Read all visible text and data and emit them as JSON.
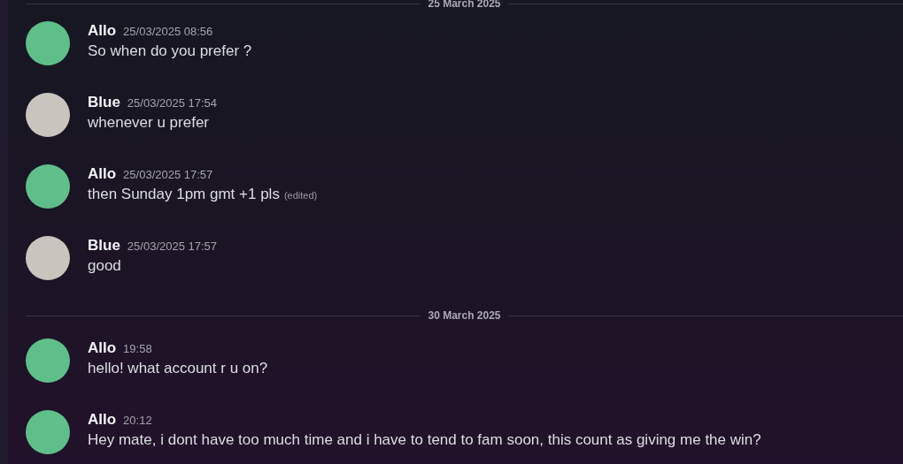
{
  "items": [
    {
      "kind": "divider",
      "label": "25 March 2025"
    },
    {
      "kind": "message",
      "author": "Allo",
      "time": "25/03/2025 08:56",
      "text": "So when do you prefer ?",
      "color": "#5fbf8a"
    },
    {
      "kind": "message",
      "author": "Blue",
      "time": "25/03/2025 17:54",
      "text": "whenever u prefer",
      "color": "#c9c4bd"
    },
    {
      "kind": "message",
      "author": "Allo",
      "time": "25/03/2025 17:57",
      "text": "then Sunday 1pm gmt +1 pls",
      "edited": "(edited)",
      "color": "#5fbf8a"
    },
    {
      "kind": "message",
      "author": "Blue",
      "time": "25/03/2025 17:57",
      "text": "good",
      "color": "#c9c4bd"
    },
    {
      "kind": "divider",
      "label": "30 March 2025"
    },
    {
      "kind": "message",
      "author": "Allo",
      "time": "19:58",
      "text": "hello! what account r u on?",
      "color": "#5fbf8a"
    },
    {
      "kind": "message",
      "author": "Allo",
      "time": "20:12",
      "text": "Hey mate, i dont have too much time and i have to tend to fam soon, this count as giving me the win?",
      "color": "#5fbf8a"
    }
  ]
}
